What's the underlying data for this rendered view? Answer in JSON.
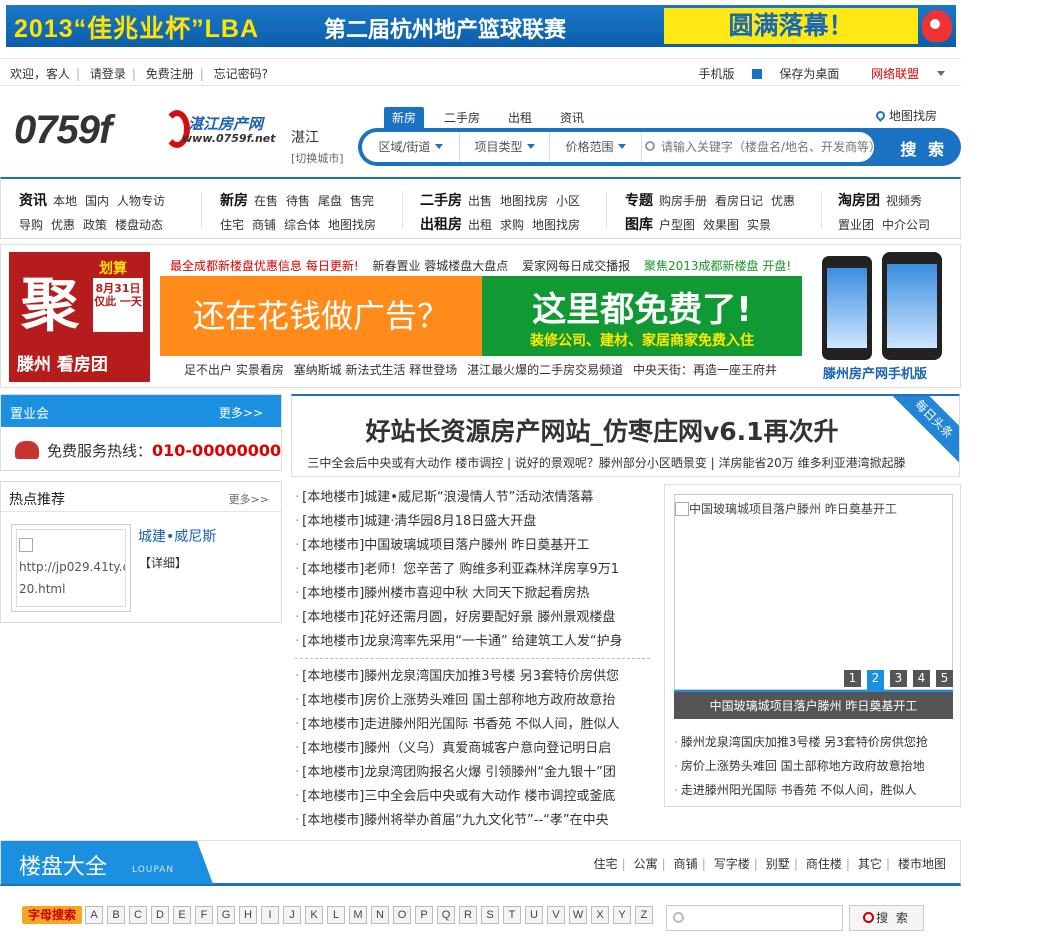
{
  "top_banner": {
    "year_text": "2013“佳兆业杯”LBA",
    "mid_text": "第二届杭州地产篮球联赛",
    "right_text": "圆满落幕！"
  },
  "login_bar": {
    "welcome": "欢迎，客人",
    "login": "请登录",
    "register": "免费注册",
    "forgot": "忘记密码?",
    "mobile": "手机版",
    "save_desktop": "保存为桌面",
    "network": "网络联盟"
  },
  "header": {
    "logo_num": "0759f",
    "logo_cn": "湛江房产网",
    "logo_url": "www.0759f.net",
    "city": "湛江",
    "switch_city": "[切换城市]",
    "map_find": "地图找房",
    "tabs": [
      "新房",
      "二手房",
      "出租",
      "资讯"
    ],
    "search": {
      "selects": [
        "区域/街道",
        "项目类型",
        "价格范围"
      ],
      "placeholder": "请输入关键字（楼盘名/地名、开发商等）",
      "button": "搜 索"
    }
  },
  "nav": {
    "col1": {
      "r1_head": "资讯",
      "r1": [
        "本地",
        "国内",
        "人物专访"
      ],
      "r2": [
        "导购",
        "优惠",
        "政策",
        "楼盘动态"
      ]
    },
    "col2": {
      "r1_head": "新房",
      "r1": [
        "在售",
        "待售",
        "尾盘",
        "售完"
      ],
      "r2": [
        "住宅",
        "商铺",
        "综合体",
        "地图找房"
      ]
    },
    "col3": {
      "r1_head": "二手房",
      "r1": [
        "出售",
        "地图找房",
        "小区"
      ],
      "r2_head": "出租房",
      "r2": [
        "出租",
        "求购",
        "地图找房"
      ]
    },
    "col4": {
      "r1_head": "专题",
      "r1": [
        "购房手册",
        "看房日记",
        "优惠"
      ],
      "r2_head": "图库",
      "r2": [
        "户型图",
        "效果图",
        "实景"
      ]
    },
    "col5": {
      "r1_head": "淘房团",
      "r1": [
        "视频秀"
      ],
      "r2": [
        "置业团",
        "中介公司"
      ]
    }
  },
  "ad": {
    "left": {
      "big": "聚",
      "huasuan": "划算",
      "tag": "8月31日 仅此 一天",
      "bottom": "滕州 看房团"
    },
    "headlines": [
      {
        "text": "最全成都新楼盘优惠信息 每日更新!",
        "color": "red"
      },
      {
        "text": "新春置业 蓉城楼盘大盘点",
        "color": "normal"
      },
      {
        "text": "爱家网每日成交播报",
        "color": "normal"
      },
      {
        "text": "聚焦2013成都新楼盘 开盘!",
        "color": "green"
      }
    ],
    "banner_left": "还在花钱做广告？",
    "banner_right_title": "这里都免费了!",
    "banner_right_sub": "装修公司、建材、家居商家免费入住",
    "links": [
      "足不出户 实景看房",
      "塞纳斯城 新法式生活 释世登场",
      "湛江最火爆的二手房交易频道",
      "中央天街：再造一座王府井"
    ],
    "phone_label": "滕州房产网手机版"
  },
  "zhiyehui": {
    "title": "置业会",
    "more": "更多>>",
    "hotline_label": "免费服务热线：",
    "hotline_num": "010-00000000"
  },
  "hot": {
    "title": "热点推荐",
    "more": "更多>>",
    "img_alt": "http://jp029.41ty.cn/",
    "img_alt2": "20.html",
    "name": "城建•威尼斯",
    "detail": "【详细】"
  },
  "headline": {
    "title": "好站长资源房产网站_仿枣庄网v6.1再次升",
    "sub": "三中全会后中央或有大动作 楼市调控 | 说好的景观呢？滕州部分小区晒景变 | 洋房能省20万 维多利亚港湾掀起滕",
    "ribbon": "每日头条"
  },
  "news": [
    "[本地楼市]城建•威尼斯“浪漫情人节”活动浓情落幕",
    "[本地楼市]城建·清华园8月18日盛大开盘",
    "[本地楼市]中国玻璃城项目落户滕州 昨日奠基开工",
    "[本地楼市]老师！您辛苦了 购维多利亚森林洋房享9万1",
    "[本地楼市]滕州楼市喜迎中秋 大同天下掀起看房热",
    "[本地楼市]花好还需月圆，好房要配好景 滕州景观楼盘",
    "[本地楼市]龙泉湾率先采用“一卡通” 给建筑工人发“护身",
    "[本地楼市]滕州龙泉湾国庆加推3号楼 另3套特价房供您",
    "[本地楼市]房价上涨势头难回 国土部称地方政府故意抬",
    "[本地楼市]走进滕州阳光国际 书香苑 不似人间，胜似人",
    "[本地楼市]滕州（义乌）真爱商城客户意向登记明日启",
    "[本地楼市]龙泉湾团购报名火爆 引领滕州“金九银十”团",
    "[本地楼市]三中全会后中央或有大动作 楼市调控或釜底",
    "[本地楼市]滕州将举办首届“九九文化节”--“孝”在中央"
  ],
  "slide": {
    "img_alt": "中国玻璃城项目落户滕州 昨日奠基开工",
    "numbers": [
      "1",
      "2",
      "3",
      "4",
      "5"
    ],
    "active": 1,
    "caption": "中国玻璃城项目落户滕州 昨日奠基开工",
    "list": [
      "滕州龙泉湾国庆加推3号楼 另3套特价房供您抢",
      "房价上涨势头难回 国土部称地方政府故意抬地",
      "走进滕州阳光国际 书香苑 不似人间，胜似人"
    ]
  },
  "loupan": {
    "title": "楼盘大全",
    "en": "LOUPAN",
    "types": [
      "住宅",
      "公寓",
      "商铺",
      "写字楼",
      "别墅",
      "商住楼",
      "其它",
      "楼市地图"
    ]
  },
  "alpha": {
    "label": "字母搜索",
    "letters": [
      "A",
      "B",
      "C",
      "D",
      "E",
      "F",
      "G",
      "H",
      "I",
      "J",
      "K",
      "L",
      "M",
      "N",
      "O",
      "P",
      "Q",
      "R",
      "S",
      "T",
      "U",
      "V",
      "W",
      "X",
      "Y",
      "Z"
    ],
    "button": "搜 索"
  },
  "colors": {
    "primary": "#1b72c3",
    "accent_red": "#d00000",
    "orange": "#ff8b1a",
    "green": "#119a33"
  }
}
